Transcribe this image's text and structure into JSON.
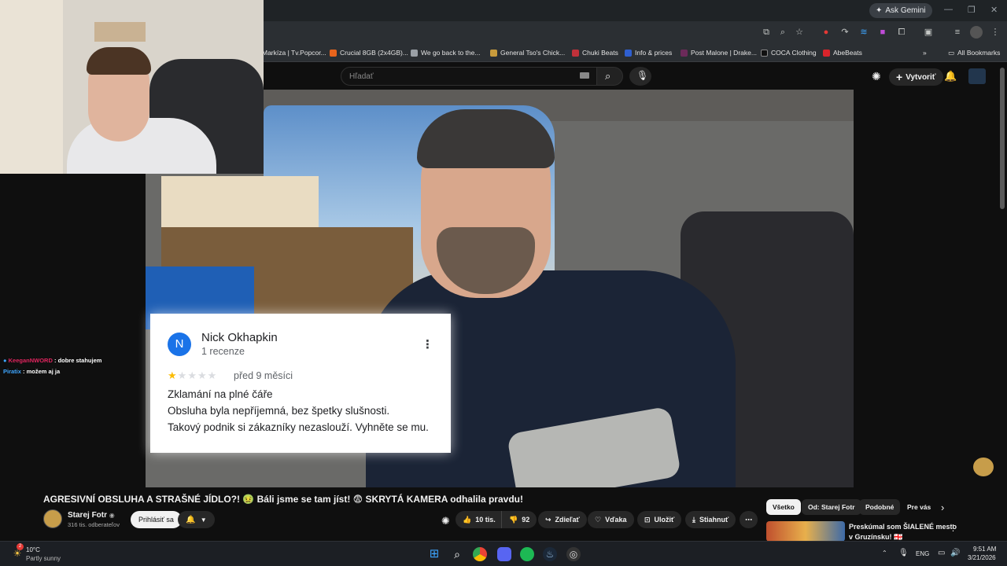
{
  "browser": {
    "gemini_label": "Ask Gemini",
    "bookmarks": [
      {
        "label": "Markíza | Tv.Popcor...",
        "color": "#3a3d41"
      },
      {
        "label": "Crucial 8GB (2x4GB)...",
        "color": "#e8641c"
      },
      {
        "label": "We go back to the...",
        "color": "#9aa0a6"
      },
      {
        "label": "General Tso's Chick...",
        "color": "#c89b3c"
      },
      {
        "label": "Chuki Beats",
        "color": "#c0313a"
      },
      {
        "label": "Info & prices",
        "color": "#2f5fd0"
      },
      {
        "label": "Post Malone | Drake...",
        "color": "#6c2a5a"
      },
      {
        "label": "COCA Clothing",
        "color": "#111111"
      },
      {
        "label": "AbeBeats",
        "color": "#d9242b"
      }
    ],
    "all_bookmarks": "All Bookmarks"
  },
  "youtube": {
    "search_placeholder": "Hľadať",
    "create_label": "Vytvoriť",
    "video_title": "AGRESIVNÍ OBSLUHA A STRAŠNÉ JÍDLO?! 🤢 Báli jsme se tam jíst! 😨 SKRYTÁ KAMERA odhalila pravdu!",
    "channel_name": "Starej Fotr",
    "subscribers": "316 tis. odberateľov",
    "subscribe_label": "Prihlásiť sa",
    "likes": "10 tis.",
    "dislikes": "92",
    "share_label": "Zdieľať",
    "thanks_label": "Vďaka",
    "save_label": "Uložiť",
    "download_label": "Stiahnuť",
    "chips": [
      "Všetko",
      "Od: Starej Fotr",
      "Podobné",
      "Pre vás"
    ],
    "rec_title_line1": "Preskúmal som ŠIALENÉ mesto",
    "rec_title_line2": "v Gruzínsku! 🇬🇪"
  },
  "review": {
    "initial": "N",
    "name": "Nick Okhapkin",
    "count": "1 recenze",
    "rating": 1,
    "time": "před 9 měsíci",
    "line1": "Zklamání na plné čáře",
    "line2": "Obsluha byla nepříjemná, bez špetky slušnosti.",
    "line3": "Takový podnik si zákazníky nezaslouží. Vyhněte se mu."
  },
  "chat": [
    {
      "user": "KeeganNWORD",
      "message": ": dobre stahujem",
      "color": "#e0245e"
    },
    {
      "user": "Piratix",
      "message": ": možem aj ja",
      "color": "#3ea6ff"
    }
  ],
  "taskbar": {
    "temperature": "10°C",
    "weather": "Partly sunny",
    "weather_badge": "2",
    "language": "ENG",
    "time": "9:51 AM",
    "date": "3/21/2026"
  }
}
